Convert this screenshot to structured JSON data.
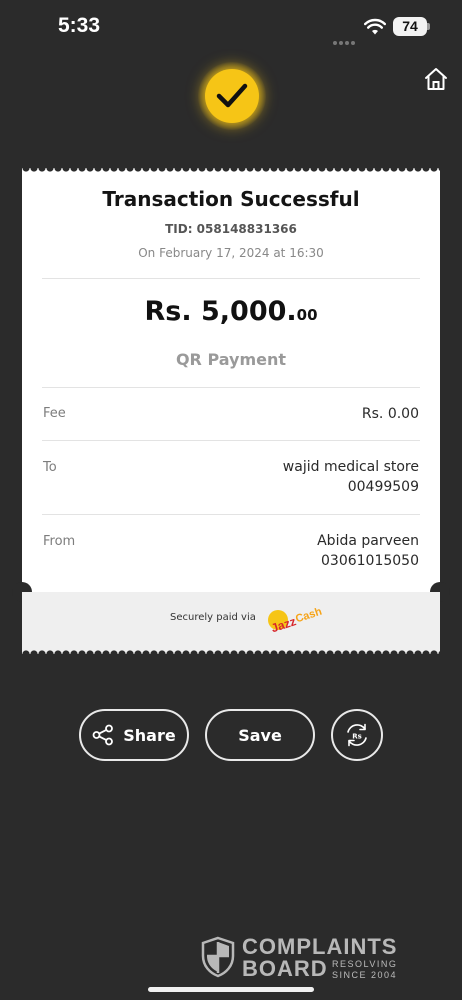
{
  "status_bar": {
    "time": "5:33",
    "battery": "74"
  },
  "receipt": {
    "title": "Transaction Successful",
    "tid": "TID: 058148831366",
    "date": "On February 17, 2024 at 16:30",
    "amount_main": "Rs. 5,000.",
    "amount_cents": "00",
    "payment_type": "QR Payment",
    "fee_label": "Fee",
    "fee_value": "Rs. 0.00",
    "to_label": "To",
    "to_name": "wajid medical store",
    "to_account": "00499509",
    "from_label": "From",
    "from_name": "Abida parveen",
    "from_account": "03061015050",
    "secure_text": "Securely paid via",
    "brand_logo_text": "JazzCash"
  },
  "actions": {
    "share_label": "Share",
    "save_label": "Save",
    "convert_icon_text": "Rs"
  },
  "watermark": {
    "line1": "COMPLAINTS",
    "line2": "BOARD",
    "tag1": "RESOLVING",
    "tag2": "SINCE 2004"
  },
  "colors": {
    "accent": "#f6c516",
    "background": "#2b2b2b",
    "card": "#ffffff",
    "brand_red": "#d7262b"
  },
  "icons": [
    "wifi-icon",
    "check-icon",
    "home-icon",
    "share-icon",
    "currency-convert-icon",
    "shield-icon"
  ]
}
